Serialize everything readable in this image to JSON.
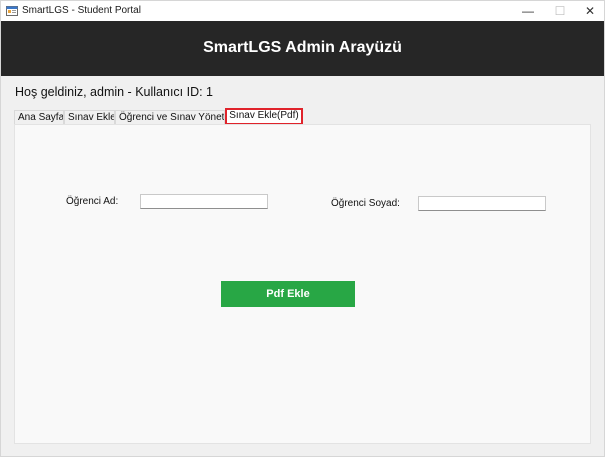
{
  "window": {
    "title": "SmartLGS - Student Portal",
    "controls": {
      "minimize": "—",
      "maximize": "☐",
      "close": "✕"
    }
  },
  "banner": {
    "title": "SmartLGS Admin Arayüzü"
  },
  "welcome": "Hoş geldiniz, admin - Kullanıcı ID: 1",
  "tabs": [
    {
      "label": "Ana Sayfa"
    },
    {
      "label": "Sınav Ekle"
    },
    {
      "label": "Öğrenci ve Sınav Yönetimi"
    },
    {
      "label": "Sınav Ekle(Pdf)",
      "selected": true
    }
  ],
  "form": {
    "ad_label": "Öğrenci Ad:",
    "ad_value": "",
    "soyad_label": "Öğrenci Soyad:",
    "soyad_value": "",
    "submit_label": "Pdf Ekle"
  },
  "colors": {
    "banner_bg": "#262626",
    "accent_green": "#28a745",
    "selected_tab_border": "#e0232b"
  },
  "icons": {
    "app": "app-window-icon"
  }
}
